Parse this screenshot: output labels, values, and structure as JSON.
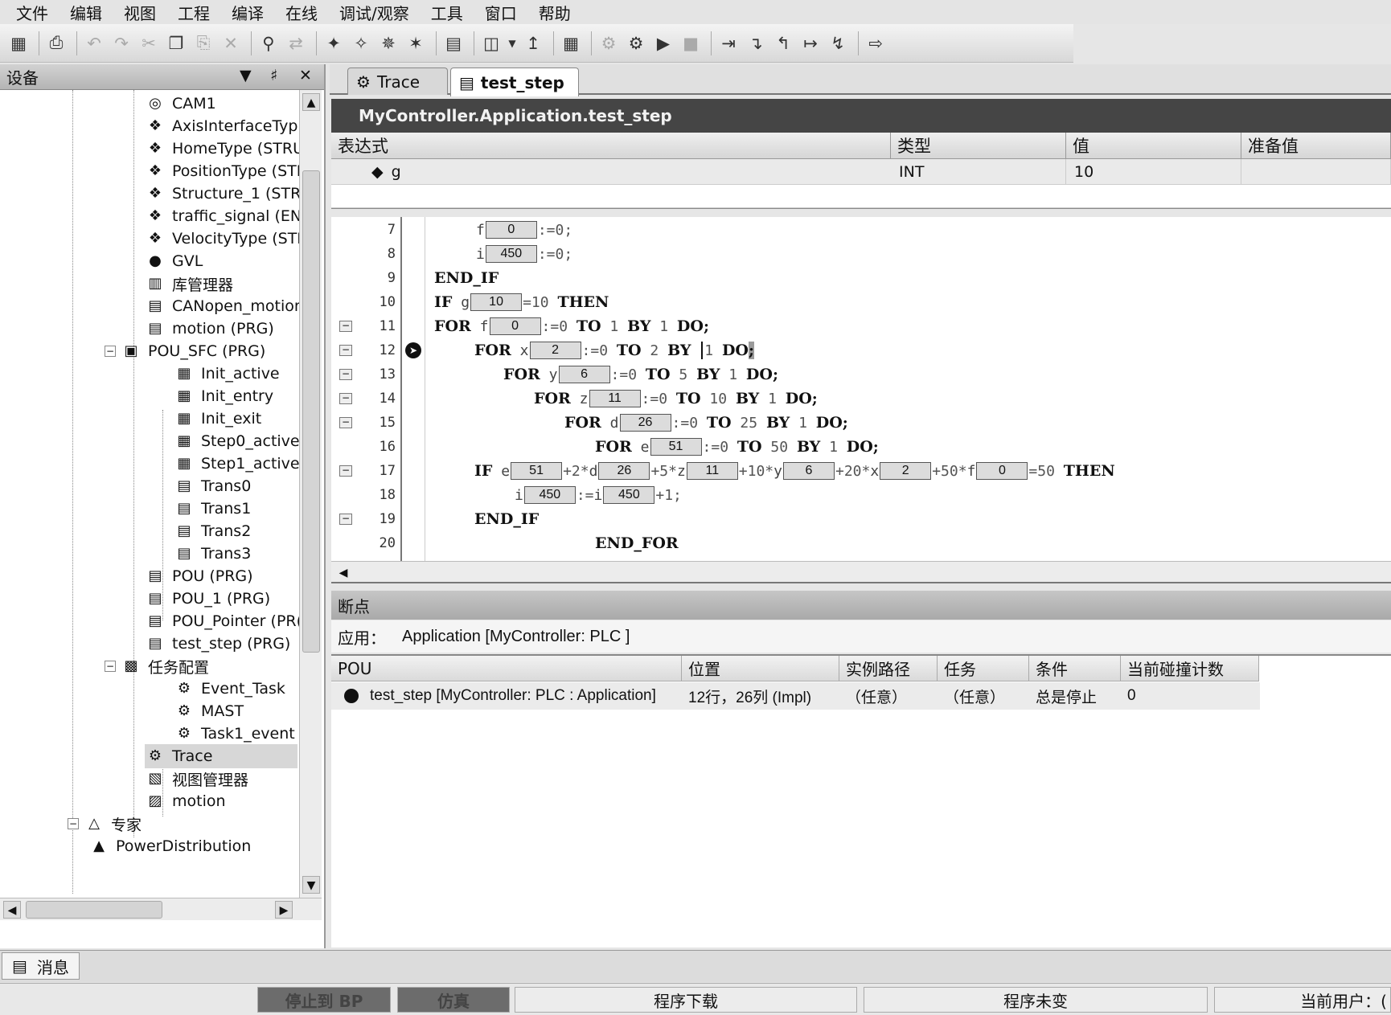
{
  "menu": [
    "文件",
    "编辑",
    "视图",
    "工程",
    "编译",
    "在线",
    "调试/观察",
    "工具",
    "窗口",
    "帮助"
  ],
  "toolbar_icons": [
    "save-icon",
    "print-icon",
    "undo-icon",
    "redo-icon",
    "cut-icon",
    "copy-icon",
    "paste-icon",
    "delete-icon",
    "find-icon",
    "replace-icon",
    "build-icon",
    "rebuild-icon",
    "clean-icon",
    "clean-all-icon",
    "generate-icon",
    "device-icon",
    "dropdown-icon",
    "download-icon",
    "visu-icon",
    "login-icon",
    "logout-icon",
    "start-icon",
    "stop-icon",
    "step-over-icon",
    "step-into-icon",
    "step-out-icon",
    "run-to-cursor-icon",
    "set-next-icon",
    "show-current-icon"
  ],
  "device_panel": {
    "title": "设备",
    "tree": [
      {
        "label": "CAM1",
        "icon": "cam-icon"
      },
      {
        "label": "AxisInterfaceTyp",
        "icon": "dut-icon"
      },
      {
        "label": "HomeType (STRU",
        "icon": "dut-icon"
      },
      {
        "label": "PositionType (STF",
        "icon": "dut-icon"
      },
      {
        "label": "Structure_1 (STR",
        "icon": "dut-icon"
      },
      {
        "label": "traffic_signal (ENI",
        "icon": "dut-icon"
      },
      {
        "label": "VelocityType (STF",
        "icon": "dut-icon"
      },
      {
        "label": "GVL",
        "icon": "globe-icon"
      },
      {
        "label": "库管理器",
        "icon": "library-icon"
      },
      {
        "label": "CANopen_motion",
        "icon": "pou-icon"
      },
      {
        "label": "motion (PRG)",
        "icon": "pou-icon"
      },
      {
        "label": "POU_SFC (PRG)",
        "icon": "sfc-icon"
      },
      {
        "label": "Init_active",
        "icon": "action-icon"
      },
      {
        "label": "Init_entry",
        "icon": "action-icon"
      },
      {
        "label": "Init_exit",
        "icon": "action-icon"
      },
      {
        "label": "Step0_active",
        "icon": "action-icon"
      },
      {
        "label": "Step1_active",
        "icon": "action-icon"
      },
      {
        "label": "Trans0",
        "icon": "transition-icon"
      },
      {
        "label": "Trans1",
        "icon": "transition-icon"
      },
      {
        "label": "Trans2",
        "icon": "transition-icon"
      },
      {
        "label": "Trans3",
        "icon": "transition-icon"
      },
      {
        "label": "POU (PRG)",
        "icon": "pou-icon"
      },
      {
        "label": "POU_1 (PRG)",
        "icon": "pou-icon"
      },
      {
        "label": "POU_Pointer (PR(",
        "icon": "pou-icon"
      },
      {
        "label": "test_step (PRG)",
        "icon": "pou-icon"
      },
      {
        "label": "任务配置",
        "icon": "task-config-icon"
      },
      {
        "label": "Event_Task",
        "icon": "task-icon"
      },
      {
        "label": "MAST",
        "icon": "task-icon"
      },
      {
        "label": "Task1_event",
        "icon": "task-icon"
      },
      {
        "label": "Trace",
        "icon": "trace-icon"
      },
      {
        "label": "视图管理器",
        "icon": "visu-manager-icon"
      },
      {
        "label": "motion",
        "icon": "visu-icon"
      },
      {
        "label": "专家",
        "icon": "expert-icon"
      },
      {
        "label": "PowerDistribution",
        "icon": "power-icon"
      }
    ]
  },
  "tabs": [
    {
      "label": "Trace",
      "icon": "trace-icon"
    },
    {
      "label": "test_step",
      "icon": "pou-icon"
    }
  ],
  "watch": {
    "path": "MyController.Application.test_step",
    "headers": [
      "表达式",
      "类型",
      "值",
      "准备值"
    ],
    "rows": [
      {
        "expression": "g",
        "type": "INT",
        "value": "10",
        "prepared": ""
      }
    ]
  },
  "code": {
    "line_numbers": [
      "7",
      "8",
      "9",
      "10",
      "11",
      "12",
      "13",
      "14",
      "15",
      "16",
      "17",
      "18",
      "19",
      "20"
    ],
    "values": {
      "l7_f": "0",
      "l8_i": "450",
      "l10_g": "10",
      "l11_f": "0",
      "l12_x": "2",
      "l13_y": "6",
      "l14_z": "11",
      "l15_d": "26",
      "l16_e": "51",
      "l17_e": "51",
      "l17_d": "26",
      "l17_z": "11",
      "l17_y": "6",
      "l17_x": "2",
      "l17_f": "0",
      "l18_i1": "450",
      "l18_i2": "450"
    }
  },
  "breakpoints": {
    "title": "断点",
    "app_label": "应用：",
    "app_value": "Application [MyController: PLC ]",
    "headers": [
      "POU",
      "位置",
      "实例路径",
      "任务",
      "条件",
      "当前碰撞计数"
    ],
    "rows": [
      {
        "pou": "test_step [MyController: PLC : Application]",
        "position": "12行，26列 (Impl)",
        "instance": "（任意）",
        "task": "（任意）",
        "condition": "总是停止",
        "hits": "0"
      }
    ]
  },
  "messages_tab": "消息",
  "status": {
    "stop_bp": "停止到 BP",
    "sim": "仿真",
    "download": "程序下载",
    "unchanged": "程序未变",
    "user": "当前用户：("
  }
}
